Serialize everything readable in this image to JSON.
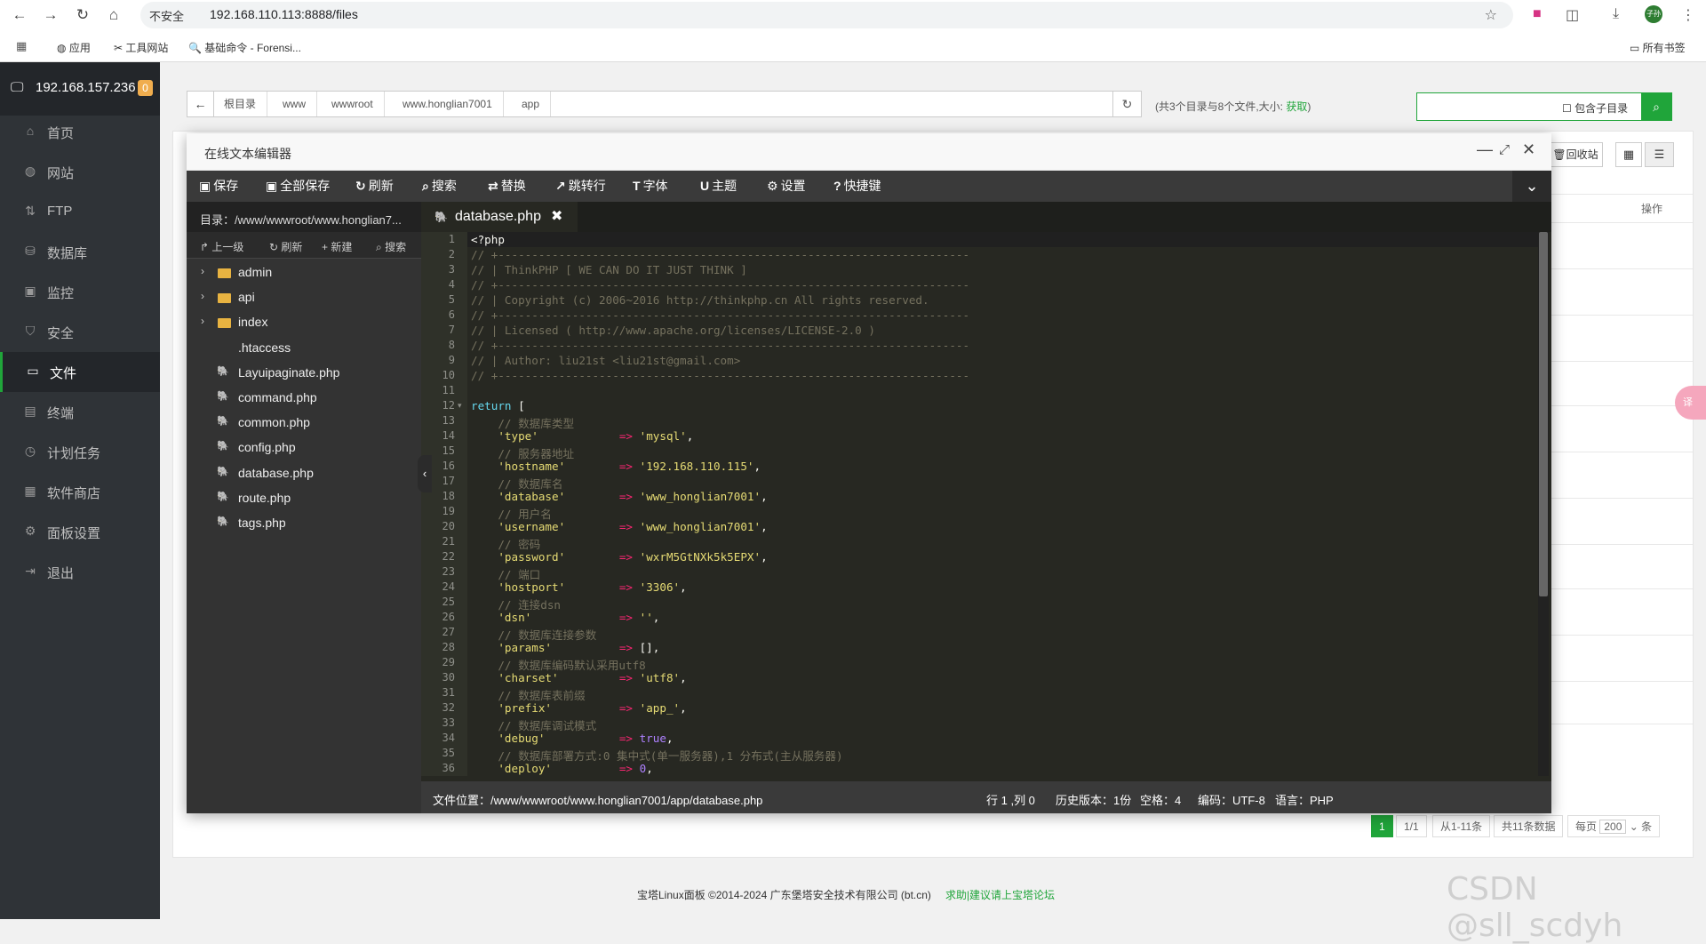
{
  "browser": {
    "insecure_label": "不安全",
    "url": "192.168.110.113:8888/files",
    "bookmarks": [
      "应用",
      "工具网站",
      "基础命令 - Forensi..."
    ],
    "all_bookmarks": "所有书签",
    "profile": "子孙"
  },
  "sidebar": {
    "host": "192.168.157.236",
    "badge": "0",
    "items": [
      {
        "label": "首页",
        "icon": "home-icon"
      },
      {
        "label": "网站",
        "icon": "globe-icon"
      },
      {
        "label": "FTP",
        "icon": "ftp-icon"
      },
      {
        "label": "数据库",
        "icon": "database-icon"
      },
      {
        "label": "监控",
        "icon": "monitor-icon"
      },
      {
        "label": "安全",
        "icon": "shield-icon"
      },
      {
        "label": "文件",
        "icon": "folder-icon",
        "active": true
      },
      {
        "label": "终端",
        "icon": "terminal-icon"
      },
      {
        "label": "计划任务",
        "icon": "clock-icon"
      },
      {
        "label": "软件商店",
        "icon": "grid-icon"
      },
      {
        "label": "面板设置",
        "icon": "gear-icon"
      },
      {
        "label": "退出",
        "icon": "logout-icon"
      }
    ]
  },
  "files": {
    "crumbs": [
      "根目录",
      "www",
      "wwwroot",
      "www.honglian7001",
      "app"
    ],
    "summary": "(共3个目录与8个文件,大小:",
    "summary_link": "获取",
    "summary_end": ")",
    "include_subdir": "包含子目录",
    "recycle": "回收站",
    "ops_header": "操作",
    "pager": {
      "current": "1",
      "pages": "1/1",
      "range": "从1-11条",
      "total": "共11条数据",
      "per_page_label": "每页",
      "per_page": "200",
      "unit": "条"
    }
  },
  "footer": {
    "copyright": "宝塔Linux面板 ©2014-2024 广东堡塔安全技术有限公司 (bt.cn)",
    "link": "求助|建议请上宝塔论坛"
  },
  "watermark": "CSDN @sll_scdyh",
  "editor": {
    "title": "在线文本编辑器",
    "toolbar": [
      "保存",
      "全部保存",
      "刷新",
      "搜索",
      "替换",
      "跳转行",
      "字体",
      "主题",
      "设置",
      "快捷键"
    ],
    "dir_label": "目录：/www/wwwroot/www.honglian7...",
    "tree_actions": [
      "上一级",
      "刷新",
      "新建",
      "搜索"
    ],
    "tree": [
      {
        "name": "admin",
        "type": "dir"
      },
      {
        "name": "api",
        "type": "dir"
      },
      {
        "name": "index",
        "type": "dir"
      },
      {
        "name": ".htaccess",
        "type": "file"
      },
      {
        "name": "Layuipaginate.php",
        "type": "php"
      },
      {
        "name": "command.php",
        "type": "php"
      },
      {
        "name": "common.php",
        "type": "php"
      },
      {
        "name": "config.php",
        "type": "php"
      },
      {
        "name": "database.php",
        "type": "php"
      },
      {
        "name": "route.php",
        "type": "php"
      },
      {
        "name": "tags.php",
        "type": "php"
      }
    ],
    "tab": "database.php",
    "code": [
      "<?php",
      "// +----------------------------------------------------------------------",
      "// | ThinkPHP [ WE CAN DO IT JUST THINK ]",
      "// +----------------------------------------------------------------------",
      "// | Copyright (c) 2006~2016 http://thinkphp.cn All rights reserved.",
      "// +----------------------------------------------------------------------",
      "// | Licensed ( http://www.apache.org/licenses/LICENSE-2.0 )",
      "// +----------------------------------------------------------------------",
      "// | Author: liu21st <liu21st@gmail.com>",
      "// +----------------------------------------------------------------------",
      "",
      "return [",
      "    // 数据库类型",
      "    'type'            => 'mysql',",
      "    // 服务器地址",
      "    'hostname'        => '192.168.110.115',",
      "    // 数据库名",
      "    'database'        => 'www_honglian7001',",
      "    // 用户名",
      "    'username'        => 'www_honglian7001',",
      "    // 密码",
      "    'password'        => 'wxrM5GtNXk5k5EPX',",
      "    // 端口",
      "    'hostport'        => '3306',",
      "    // 连接dsn",
      "    'dsn'             => '',",
      "    // 数据库连接参数",
      "    'params'          => [],",
      "    // 数据库编码默认采用utf8",
      "    'charset'         => 'utf8',",
      "    // 数据库表前缀",
      "    'prefix'          => 'app_',",
      "    // 数据库调试模式",
      "    'debug'           => true,",
      "    // 数据库部署方式:0 集中式(单一服务器),1 分布式(主从服务器)",
      "    'deploy'          => 0,"
    ],
    "status": {
      "file_path": "文件位置：/www/wwwroot/www.honglian7001/app/database.php",
      "cursor": "行 1 ,列 0",
      "history": "历史版本：1份",
      "indent": "空格：4",
      "encoding": "编码：UTF-8",
      "language": "语言：PHP"
    }
  },
  "colors": {
    "accent": "#20a53a",
    "sidebar": "#2f3337",
    "editor_bg": "#272822"
  }
}
